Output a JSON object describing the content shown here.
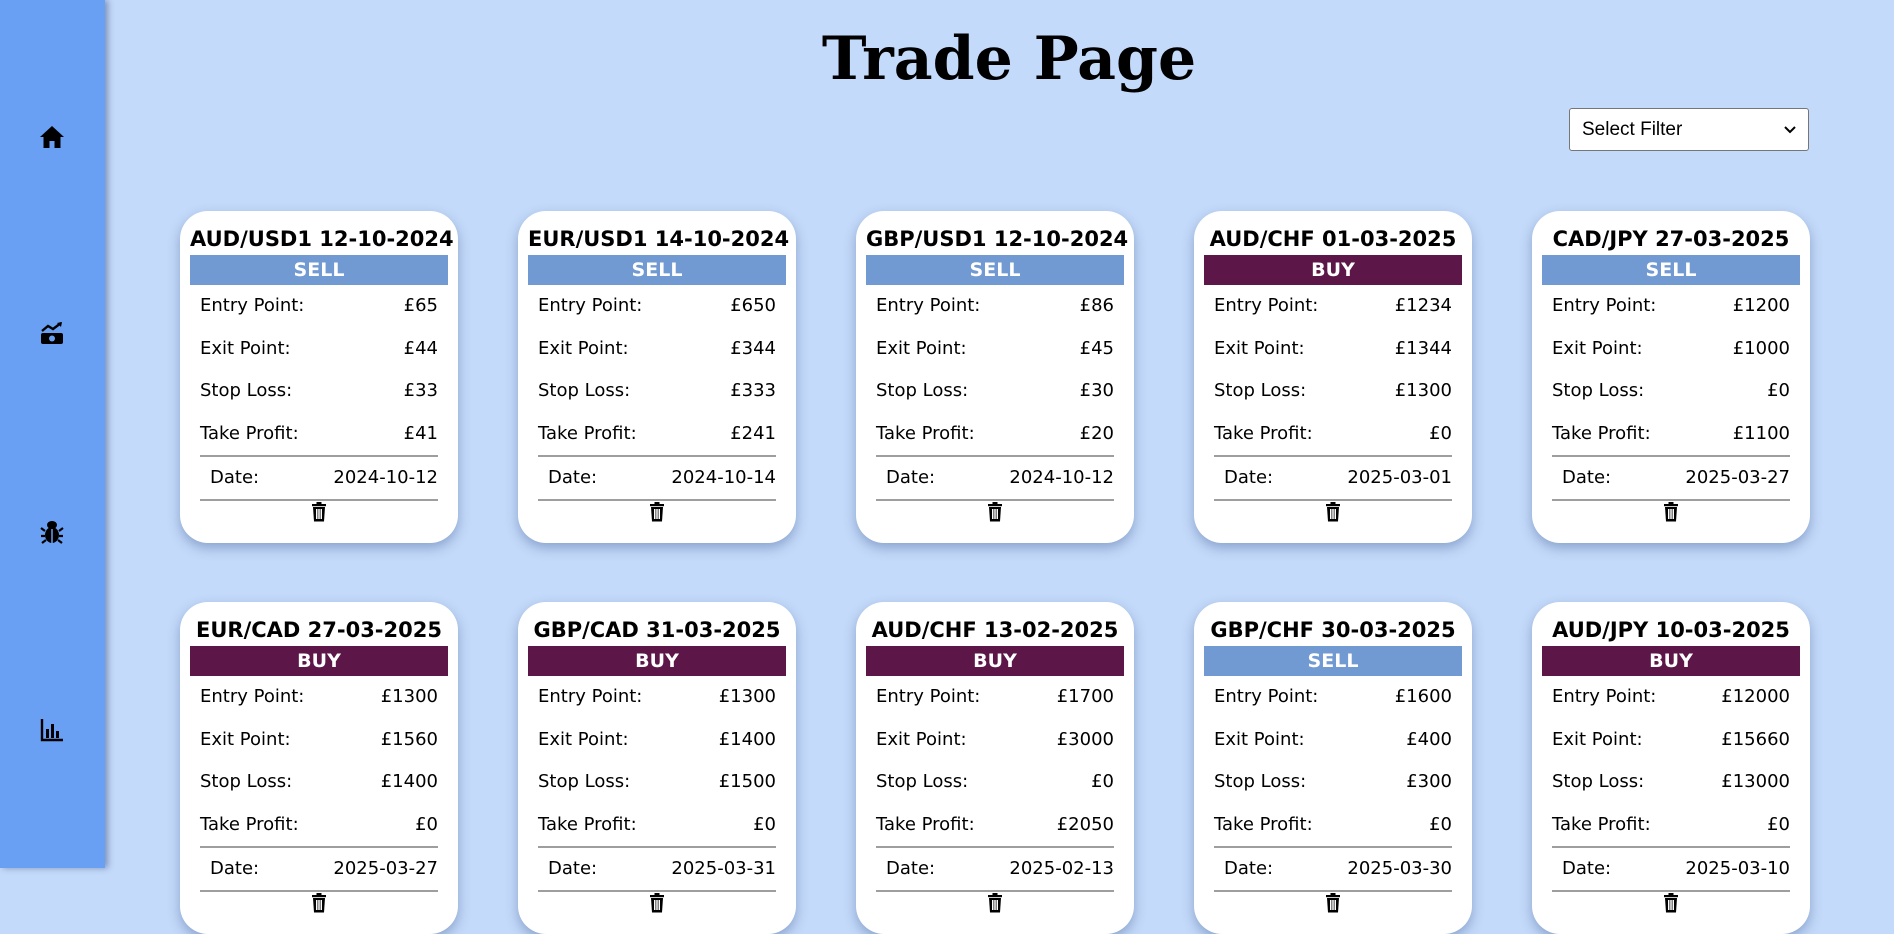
{
  "page": {
    "title": "Trade Page"
  },
  "filter": {
    "selected": "Select Filter"
  },
  "labels": {
    "entry": "Entry Point:",
    "exit": "Exit Point:",
    "stop": "Stop Loss:",
    "take": "Take Profit:",
    "date": "Date:"
  },
  "colors": {
    "sell": "#7199d2",
    "buy": "#5c1647"
  },
  "trades": [
    {
      "title": "AUD/USD1 12-10-2024",
      "side": "SELL",
      "entry": "£65",
      "exit": "£44",
      "stop": "£33",
      "take": "£41",
      "date": "2024-10-12"
    },
    {
      "title": "EUR/USD1 14-10-2024",
      "side": "SELL",
      "entry": "£650",
      "exit": "£344",
      "stop": "£333",
      "take": "£241",
      "date": "2024-10-14"
    },
    {
      "title": "GBP/USD1 12-10-2024",
      "side": "SELL",
      "entry": "£86",
      "exit": "£45",
      "stop": "£30",
      "take": "£20",
      "date": "2024-10-12"
    },
    {
      "title": "AUD/CHF 01-03-2025",
      "side": "BUY",
      "entry": "£1234",
      "exit": "£1344",
      "stop": "£1300",
      "take": "£0",
      "date": "2025-03-01"
    },
    {
      "title": "CAD/JPY 27-03-2025",
      "side": "SELL",
      "entry": "£1200",
      "exit": "£1000",
      "stop": "£0",
      "take": "£1100",
      "date": "2025-03-27"
    },
    {
      "title": "EUR/CAD 27-03-2025",
      "side": "BUY",
      "entry": "£1300",
      "exit": "£1560",
      "stop": "£1400",
      "take": "£0",
      "date": "2025-03-27"
    },
    {
      "title": "GBP/CAD 31-03-2025",
      "side": "BUY",
      "entry": "£1300",
      "exit": "£1400",
      "stop": "£1500",
      "take": "£0",
      "date": "2025-03-31"
    },
    {
      "title": "AUD/CHF 13-02-2025",
      "side": "BUY",
      "entry": "£1700",
      "exit": "£3000",
      "stop": "£0",
      "take": "£2050",
      "date": "2025-02-13"
    },
    {
      "title": "GBP/CHF 30-03-2025",
      "side": "SELL",
      "entry": "£1600",
      "exit": "£400",
      "stop": "£300",
      "take": "£0",
      "date": "2025-03-30"
    },
    {
      "title": "AUD/JPY 10-03-2025",
      "side": "BUY",
      "entry": "£12000",
      "exit": "£15660",
      "stop": "£13000",
      "take": "£0",
      "date": "2025-03-10"
    }
  ]
}
